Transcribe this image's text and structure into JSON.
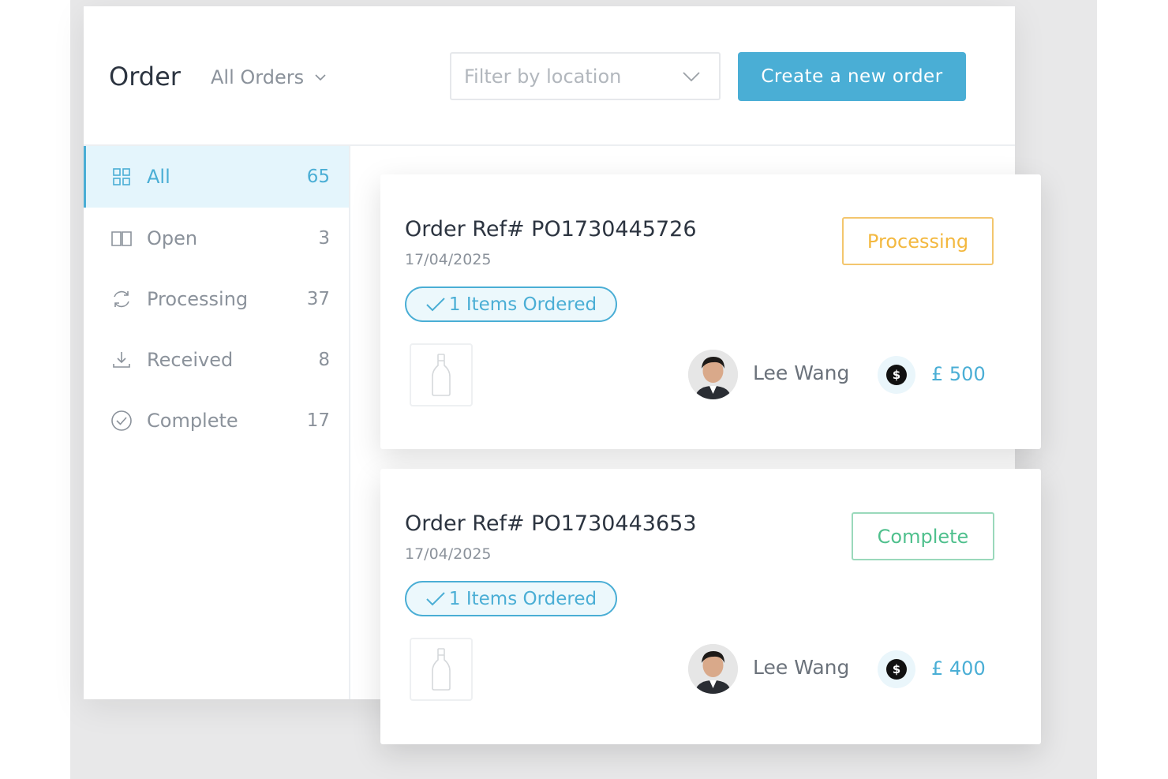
{
  "header": {
    "title": "Order",
    "view_select": "All Orders",
    "location_placeholder": "Filter by location",
    "create_button": "Create a new order"
  },
  "sidebar": {
    "items": [
      {
        "label": "All",
        "count": "65",
        "icon": "grid-icon",
        "active": true
      },
      {
        "label": "Open",
        "count": "3",
        "icon": "book-open-icon",
        "active": false
      },
      {
        "label": "Processing",
        "count": "37",
        "icon": "refresh-icon",
        "active": false
      },
      {
        "label": "Received",
        "count": "8",
        "icon": "download-icon",
        "active": false
      },
      {
        "label": "Complete",
        "count": "17",
        "icon": "check-circle-icon",
        "active": false
      }
    ]
  },
  "orders": [
    {
      "ref": "Order Ref# PO1730445726",
      "date": "17/04/2025",
      "items_label": "1 Items Ordered",
      "status": "Processing",
      "status_color": "#f3b83f",
      "customer": "Lee Wang",
      "amount": "£ 500"
    },
    {
      "ref": "Order Ref# PO1730443653",
      "date": "17/04/2025",
      "items_label": "1 Items Ordered",
      "status": "Complete",
      "status_color": "#4fc08d",
      "customer": "Lee Wang",
      "amount": "£ 400"
    }
  ],
  "colors": {
    "accent": "#4aaed5",
    "processing": "#f3b83f",
    "complete": "#4fc08d"
  }
}
